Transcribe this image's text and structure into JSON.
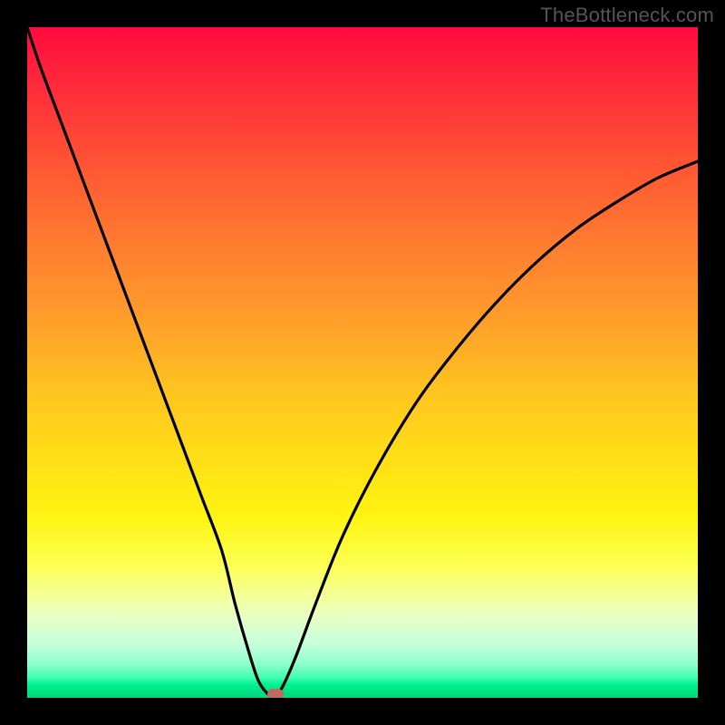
{
  "watermark": "TheBottleneck.com",
  "colors": {
    "curve": "#000000",
    "marker": "#c1695c",
    "frame_bg": "#000000"
  },
  "chart_data": {
    "type": "line",
    "title": "",
    "xlabel": "",
    "ylabel": "",
    "xlim": [
      0,
      100
    ],
    "ylim": [
      0,
      100
    ],
    "grid": false,
    "series": [
      {
        "name": "bottleneck-curve",
        "x": [
          0,
          2,
          5,
          8,
          11,
          14,
          17,
          20,
          23,
          26,
          29,
          31,
          33,
          34.5,
          36,
          37,
          38,
          40,
          43,
          47,
          52,
          58,
          64,
          70,
          76,
          82,
          88,
          94,
          100
        ],
        "y": [
          100,
          94,
          86,
          78,
          70,
          62,
          54,
          46,
          38,
          30,
          22,
          14,
          7,
          2.5,
          0.5,
          0.3,
          1.5,
          6,
          14,
          24,
          34,
          44,
          52,
          59,
          65,
          70,
          74,
          77.5,
          80
        ]
      }
    ],
    "marker": {
      "x": 37,
      "y": 0.5
    }
  }
}
